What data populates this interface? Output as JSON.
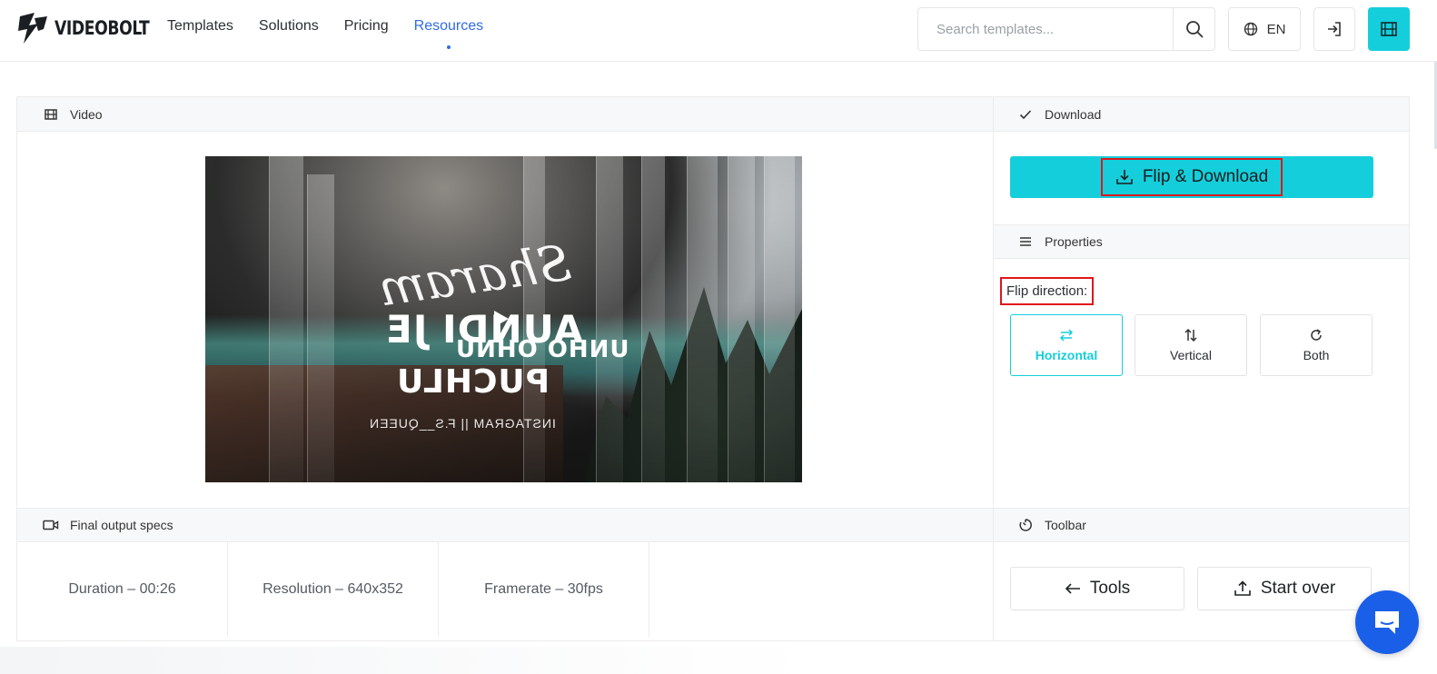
{
  "brand": {
    "name": "VIDEOBOLT",
    "accent": "#14cfdb",
    "link_active": "#2f6be8",
    "highlight": "#e0161c"
  },
  "nav": {
    "items": [
      {
        "label": "Templates"
      },
      {
        "label": "Solutions"
      },
      {
        "label": "Pricing"
      },
      {
        "label": "Resources",
        "active": true
      }
    ]
  },
  "header": {
    "search_placeholder": "Search templates...",
    "search_icon": "search-icon",
    "language": "EN",
    "login_icon": "login-icon",
    "app_icon": "film-icon"
  },
  "video_section": {
    "title": "Video",
    "icon": "film-icon"
  },
  "download_section": {
    "title": "Download",
    "icon": "check-icon",
    "button_label": "Flip & Download"
  },
  "properties_section": {
    "title": "Properties",
    "icon": "menu-icon",
    "flip_label": "Flip direction:",
    "options": [
      {
        "label": "Horizontal",
        "icon": "swap-horizontal-icon",
        "selected": true
      },
      {
        "label": "Vertical",
        "icon": "swap-vertical-icon",
        "selected": false
      },
      {
        "label": "Both",
        "icon": "rotate-icon",
        "selected": false
      }
    ]
  },
  "specs_section": {
    "title": "Final output specs",
    "icon": "video-camera-icon",
    "items": [
      {
        "label": "Duration – 00:26"
      },
      {
        "label": "Resolution – 640x352"
      },
      {
        "label": "Framerate – 30fps"
      }
    ]
  },
  "toolbar_section": {
    "title": "Toolbar",
    "icon": "timer-icon",
    "tools_label": "Tools",
    "start_over_label": "Start over"
  },
  "chat": {
    "icon": "chat-icon"
  }
}
